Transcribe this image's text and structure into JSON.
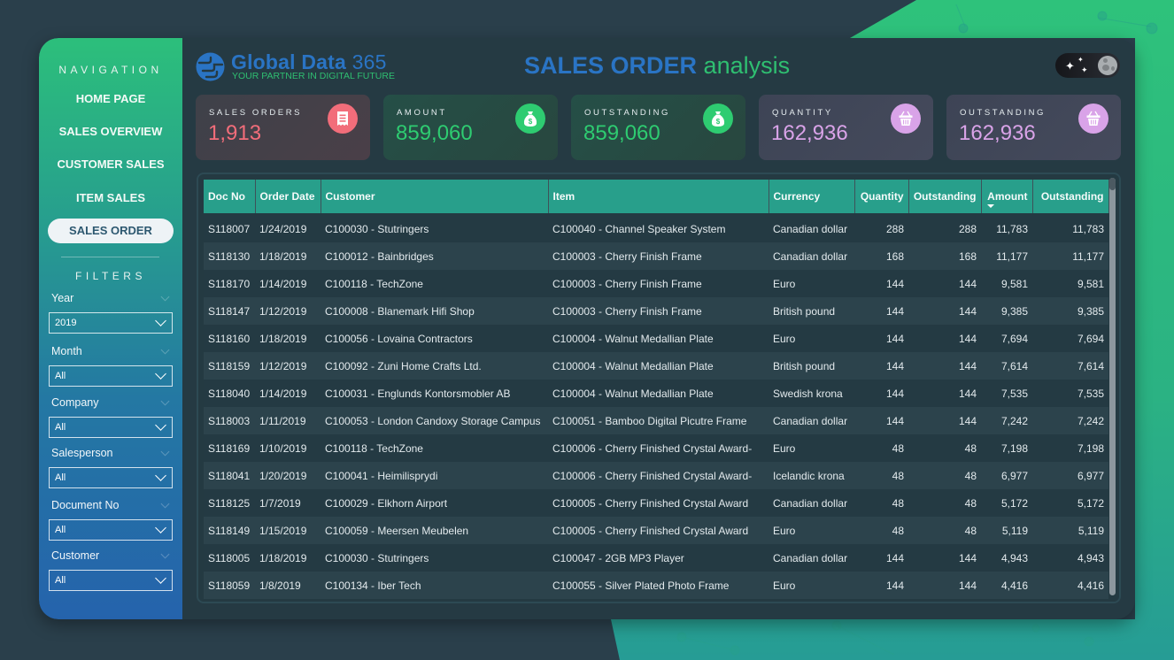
{
  "brand": {
    "name_bold": "Global Data",
    "name_num": "365",
    "tagline": "YOUR PARTNER IN DIGITAL FUTURE"
  },
  "header": {
    "title_part1": "SALES ORDER",
    "title_part2": "analysis",
    "theme_toggle": "dark-mode-toggle"
  },
  "sidebar": {
    "nav_heading": "NAVIGATION",
    "nav_items": [
      {
        "label": "HOME PAGE",
        "active": false
      },
      {
        "label": "SALES OVERVIEW",
        "active": false
      },
      {
        "label": "CUSTOMER SALES",
        "active": false
      },
      {
        "label": "ITEM SALES",
        "active": false
      },
      {
        "label": "SALES ORDER",
        "active": true
      }
    ],
    "filters_heading": "FILTERS",
    "filters": [
      {
        "label": "Year",
        "value": "2019"
      },
      {
        "label": "Month",
        "value": "All"
      },
      {
        "label": "Company",
        "value": "All"
      },
      {
        "label": "Salesperson",
        "value": "All"
      },
      {
        "label": "Document No",
        "value": "All"
      },
      {
        "label": "Customer",
        "value": "All"
      }
    ]
  },
  "kpis": [
    {
      "label": "SALES ORDERS",
      "value": "1,913",
      "icon": "receipt-icon",
      "color": "#f26d7a"
    },
    {
      "label": "AMOUNT",
      "value": "859,060",
      "icon": "money-bag-icon",
      "color": "#2ecc71"
    },
    {
      "label": "OUTSTANDING",
      "value": "859,060",
      "icon": "money-bag-icon",
      "color": "#2ecc71"
    },
    {
      "label": "QUANTITY",
      "value": "162,936",
      "icon": "basket-icon",
      "color": "#d9a3e8"
    },
    {
      "label": "OUTSTANDING",
      "value": "162,936",
      "icon": "basket-icon",
      "color": "#d9a3e8"
    }
  ],
  "table": {
    "columns": [
      "Doc No",
      "Order Date",
      "Customer",
      "Item",
      "Currency",
      "Quantity",
      "Outstanding",
      "Amount",
      "Outstanding"
    ],
    "sorted_column": "Amount",
    "sort_direction": "descending",
    "rows": [
      [
        "S118007",
        "1/24/2019",
        "C100030 - Stutringers",
        "C100040 - Channel Speaker System",
        "Canadian dollar",
        "288",
        "288",
        "11,783",
        "11,783"
      ],
      [
        "S118130",
        "1/18/2019",
        "C100012 - Bainbridges",
        "C100003 - Cherry Finish Frame",
        "Canadian dollar",
        "168",
        "168",
        "11,177",
        "11,177"
      ],
      [
        "S118170",
        "1/14/2019",
        "C100118 - TechZone",
        "C100003 - Cherry Finish Frame",
        "Euro",
        "144",
        "144",
        "9,581",
        "9,581"
      ],
      [
        "S118147",
        "1/12/2019",
        "C100008 - Blanemark Hifi Shop",
        "C100003 - Cherry Finish Frame",
        "British pound",
        "144",
        "144",
        "9,385",
        "9,385"
      ],
      [
        "S118160",
        "1/18/2019",
        "C100056 - Lovaina Contractors",
        "C100004 - Walnut Medallian Plate",
        "Euro",
        "144",
        "144",
        "7,694",
        "7,694"
      ],
      [
        "S118159",
        "1/12/2019",
        "C100092 - Zuni Home Crafts Ltd.",
        "C100004 - Walnut Medallian Plate",
        "British pound",
        "144",
        "144",
        "7,614",
        "7,614"
      ],
      [
        "S118040",
        "1/14/2019",
        "C100031 - Englunds Kontorsmobler AB",
        "C100004 - Walnut Medallian Plate",
        "Swedish krona",
        "144",
        "144",
        "7,535",
        "7,535"
      ],
      [
        "S118003",
        "1/11/2019",
        "C100053 - London Candoxy Storage Campus",
        "C100051 - Bamboo Digital Picutre Frame",
        "Canadian dollar",
        "144",
        "144",
        "7,242",
        "7,242"
      ],
      [
        "S118169",
        "1/10/2019",
        "C100118 - TechZone",
        "C100006 - Cherry Finished Crystal Award-",
        "Euro",
        "48",
        "48",
        "7,198",
        "7,198"
      ],
      [
        "S118041",
        "1/20/2019",
        "C100041 - Heimilisprydi",
        "C100006 - Cherry Finished Crystal Award-",
        "Icelandic krona",
        "48",
        "48",
        "6,977",
        "6,977"
      ],
      [
        "S118125",
        "1/7/2019",
        "C100029 - Elkhorn Airport",
        "C100005 - Cherry Finished Crystal Award",
        "Canadian dollar",
        "48",
        "48",
        "5,172",
        "5,172"
      ],
      [
        "S118149",
        "1/15/2019",
        "C100059 - Meersen Meubelen",
        "C100005 - Cherry Finished Crystal Award",
        "Euro",
        "48",
        "48",
        "5,119",
        "5,119"
      ],
      [
        "S118005",
        "1/18/2019",
        "C100030 - Stutringers",
        "C100047 - 2GB MP3 Player",
        "Canadian dollar",
        "144",
        "144",
        "4,943",
        "4,943"
      ],
      [
        "S118059",
        "1/8/2019",
        "C100134 - Iber Tech",
        "C100055 - Silver Plated Photo Frame",
        "Euro",
        "144",
        "144",
        "4,416",
        "4,416"
      ]
    ]
  },
  "colors": {
    "brand_blue": "#2a74c4",
    "brand_green": "#2fbf71",
    "table_header": "#289f8b",
    "panel_bg": "#253a43"
  }
}
